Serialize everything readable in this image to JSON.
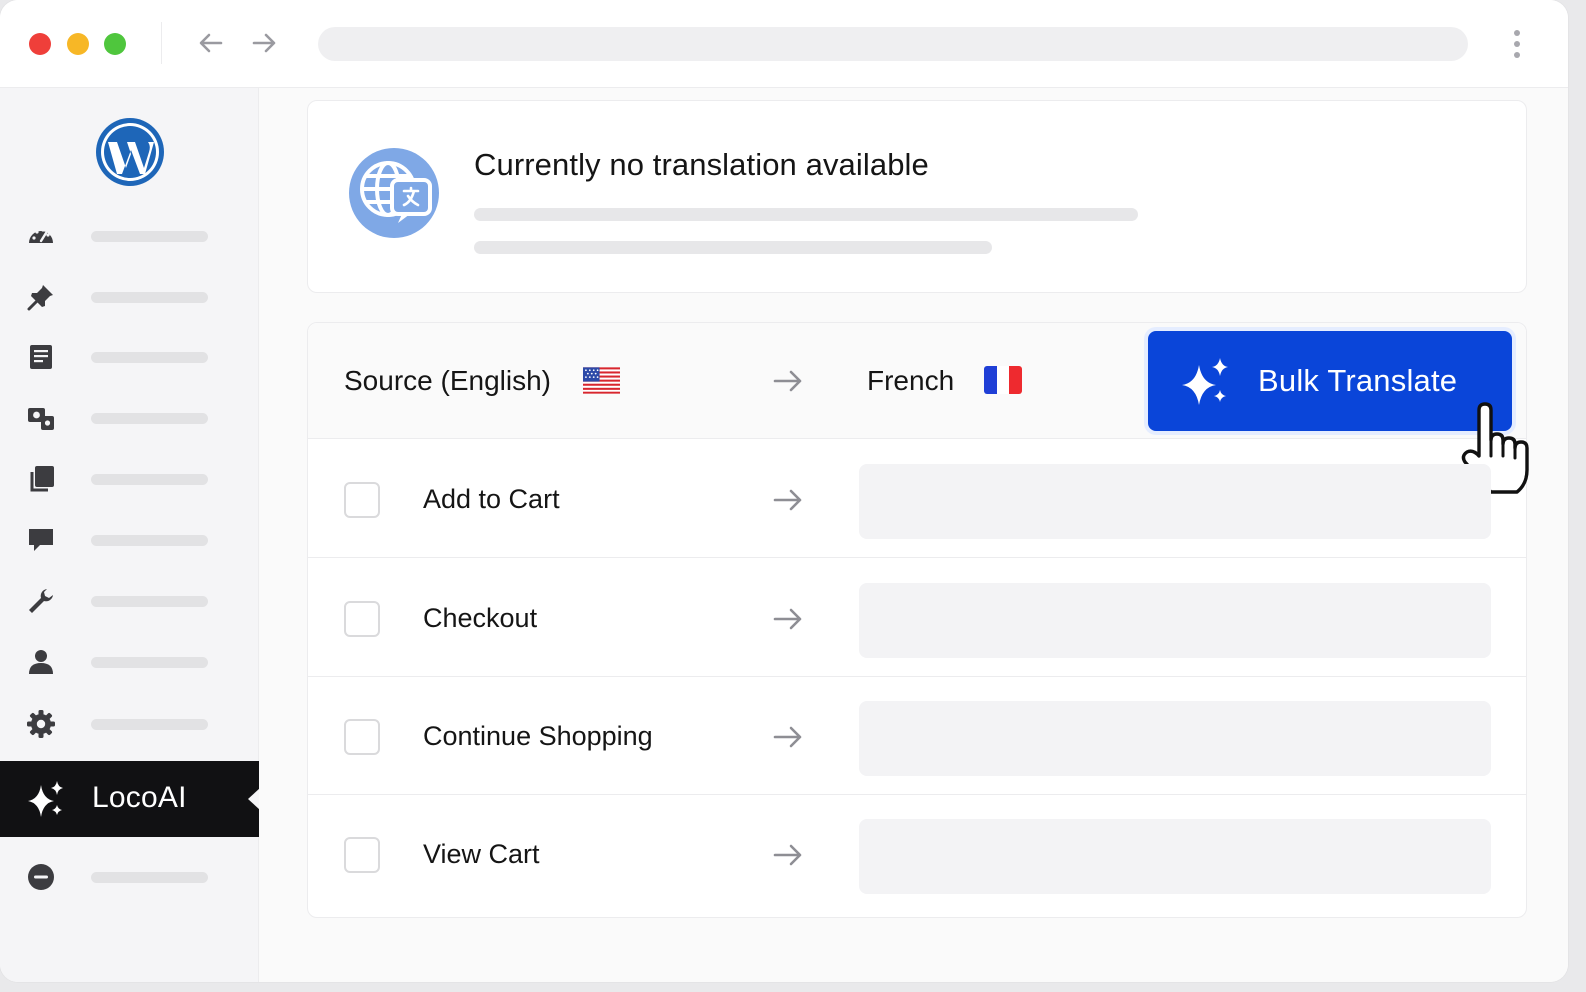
{
  "colors": {
    "close": "#ef3f3a",
    "minimize": "#f7b726",
    "maximize": "#4fc63d",
    "accent": "#0a45d9",
    "wordpress": "#1e66b8",
    "globe": "#7fa8e6"
  },
  "sidebar": {
    "icons": [
      "dashboard-icon",
      "pin-icon",
      "pages-icon",
      "media-icon",
      "copy-icon",
      "comment-icon",
      "wrench-icon",
      "user-icon",
      "gear-icon"
    ],
    "active_item": {
      "label": "LocoAI",
      "icon": "sparkle-icon"
    },
    "bottom_icon": "collapse-icon"
  },
  "notice": {
    "title": "Currently no translation available"
  },
  "table": {
    "source_label": "Source (English)",
    "target_label": "French",
    "bulk_button_label": "Bulk Translate",
    "rows": [
      {
        "label": "Add to Cart"
      },
      {
        "label": "Checkout"
      },
      {
        "label": "Continue Shopping"
      },
      {
        "label": "View Cart"
      }
    ]
  }
}
